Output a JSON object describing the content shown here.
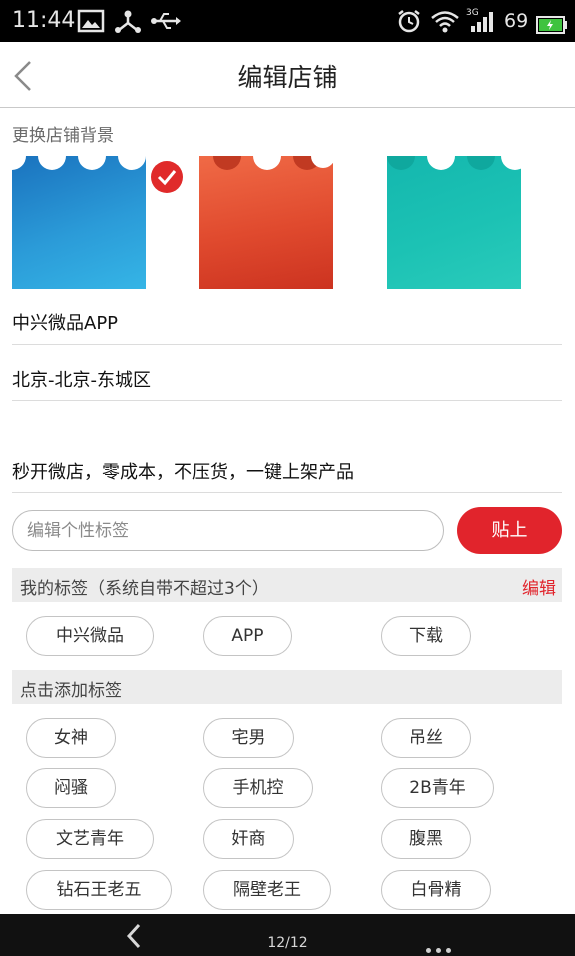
{
  "status_bar": {
    "time": "11:44",
    "network_type": "3G",
    "battery_level": "69",
    "icons": [
      "image-icon",
      "usb-debug-icon",
      "usb-icon",
      "alarm-icon",
      "wifi-icon",
      "signal-icon",
      "battery-icon"
    ]
  },
  "header": {
    "title": "编辑店铺",
    "back_icon": "chevron-left-icon"
  },
  "backgrounds": {
    "label": "更换店铺背景",
    "options": [
      {
        "name": "blue",
        "color_top": "#1a86cc",
        "color_bottom": "#2aa7e0",
        "selected": true
      },
      {
        "name": "red",
        "color_top": "#e05a3c",
        "color_bottom": "#d23a22",
        "selected": false
      },
      {
        "name": "teal",
        "color_top": "#18bdb0",
        "color_bottom": "#27c8b8",
        "selected": false
      }
    ]
  },
  "shop": {
    "name": "中兴微品APP",
    "location": "北京-北京-东城区",
    "slogan": "秒开微店，零成本，不压货，一键上架产品"
  },
  "tag_input": {
    "placeholder": "编辑个性标签",
    "paste_label": "贴上"
  },
  "my_tags": {
    "label": "我的标签（系统自带不超过3个）",
    "edit_label": "编辑",
    "tags": [
      "中兴微品",
      "APP",
      "下载"
    ]
  },
  "add_tags": {
    "label": "点击添加标签",
    "tags": [
      "女神",
      "宅男",
      "吊丝",
      "闷骚",
      "手机控",
      "2B青年",
      "文艺青年",
      "奸商",
      "腹黑",
      "钻石王老五",
      "隔壁老王",
      "白骨精"
    ]
  },
  "nav": {
    "page_indicator": "12/12"
  },
  "colors": {
    "accent": "#e1242c",
    "divider": "#dcdcdc",
    "gray_bar": "#ececec"
  }
}
